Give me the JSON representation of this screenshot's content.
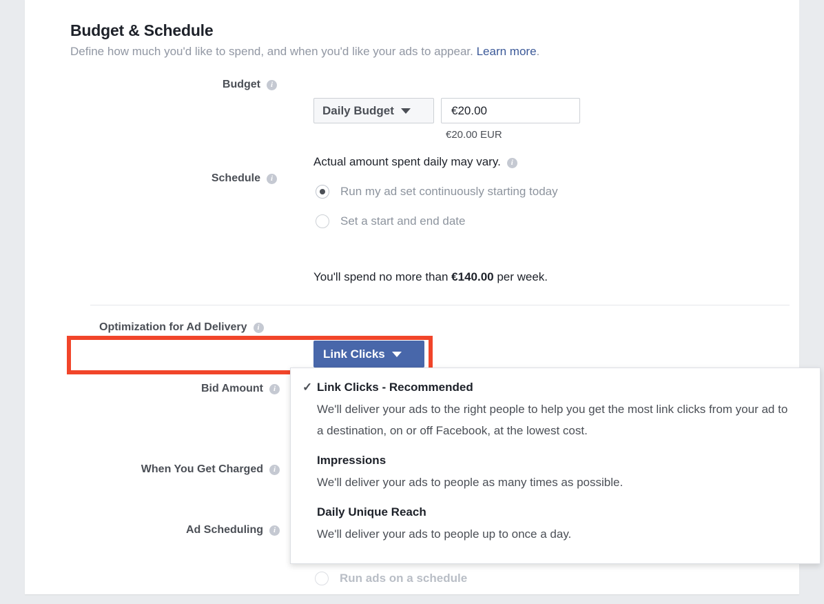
{
  "section": {
    "title": "Budget & Schedule",
    "subtitle_prefix": "Define how much you'd like to spend, and when you'd like your ads to appear. ",
    "learn_more_label": "Learn more",
    "subtitle_suffix": "."
  },
  "budget": {
    "label": "Budget",
    "type_value": "Daily Budget",
    "amount_value": "€20.00",
    "currency_note": "€20.00 EUR",
    "actual_note": "Actual amount spent daily may vary."
  },
  "schedule": {
    "label": "Schedule",
    "options": [
      {
        "label": "Run my ad set continuously starting today",
        "selected": true
      },
      {
        "label": "Set a start and end date",
        "selected": false
      }
    ],
    "spend_prefix": "You'll spend no more than ",
    "spend_amount": "€140.00",
    "spend_suffix": " per week."
  },
  "optimization": {
    "label": "Optimization for Ad Delivery",
    "selected_value": "Link Clicks",
    "highlight_color": "#f1452a",
    "button_color": "#4867aa",
    "check_glyph": "✓",
    "options": [
      {
        "title": "Link Clicks - Recommended",
        "checked": true,
        "description": "We'll deliver your ads to the right people to help you get the most link clicks from your ad to a destination, on or off Facebook, at the lowest cost."
      },
      {
        "title": "Impressions",
        "checked": false,
        "description": "We'll deliver your ads to people as many times as possible."
      },
      {
        "title": "Daily Unique Reach",
        "checked": false,
        "description": "We'll deliver your ads to people up to once a day."
      }
    ]
  },
  "bid_amount": {
    "label": "Bid Amount"
  },
  "when_charged": {
    "label": "When You Get Charged"
  },
  "ad_scheduling": {
    "label": "Ad Scheduling",
    "option_label": "Run ads on a schedule"
  },
  "icons": {
    "info": "i",
    "caret_down": "caret-down-icon"
  }
}
